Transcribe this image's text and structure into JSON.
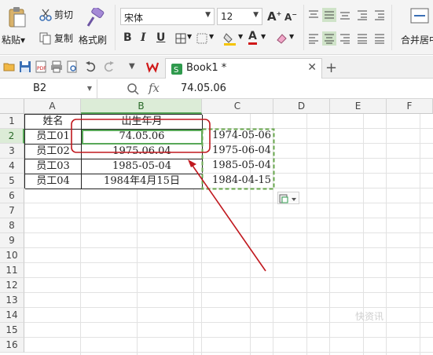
{
  "ribbon": {
    "paste_label": "粘贴",
    "cut_label": "剪切",
    "copy_label": "复制",
    "format_painter_label": "格式刷",
    "font_name": "宋体",
    "font_size": "12",
    "bold": "B",
    "italic": "I",
    "underline": "U",
    "merge_label": "合并居中"
  },
  "tabs": {
    "doc_title": "Book1 *"
  },
  "formula_bar": {
    "name_box": "B2",
    "fx_label": "fx",
    "value": "74.05.06"
  },
  "columns": [
    "A",
    "B",
    "C",
    "D",
    "E",
    "F"
  ],
  "selected_column": "B",
  "rows": [
    "1",
    "2",
    "3",
    "4",
    "5",
    "6",
    "7",
    "8",
    "9",
    "10",
    "11",
    "12",
    "13",
    "14",
    "15",
    "16"
  ],
  "selected_row": "2",
  "table": {
    "header": {
      "name": "姓名",
      "birth": "出生年月"
    },
    "data": [
      {
        "name": "员工01",
        "birth": "74.05.06",
        "converted": "1974-05-06"
      },
      {
        "name": "员工02",
        "birth": "1975.06.04",
        "converted": "1975-06-04"
      },
      {
        "name": "员工03",
        "birth": "1985-05-04",
        "converted": "1985-05-04"
      },
      {
        "name": "员工04",
        "birth": "1984年4月15日",
        "converted": "1984-04-15"
      }
    ]
  },
  "colors": {
    "selection_green": "#58a858",
    "annotation_red": "#c0181e",
    "paste_border": "#6aa84f"
  },
  "watermark": "快资讯"
}
